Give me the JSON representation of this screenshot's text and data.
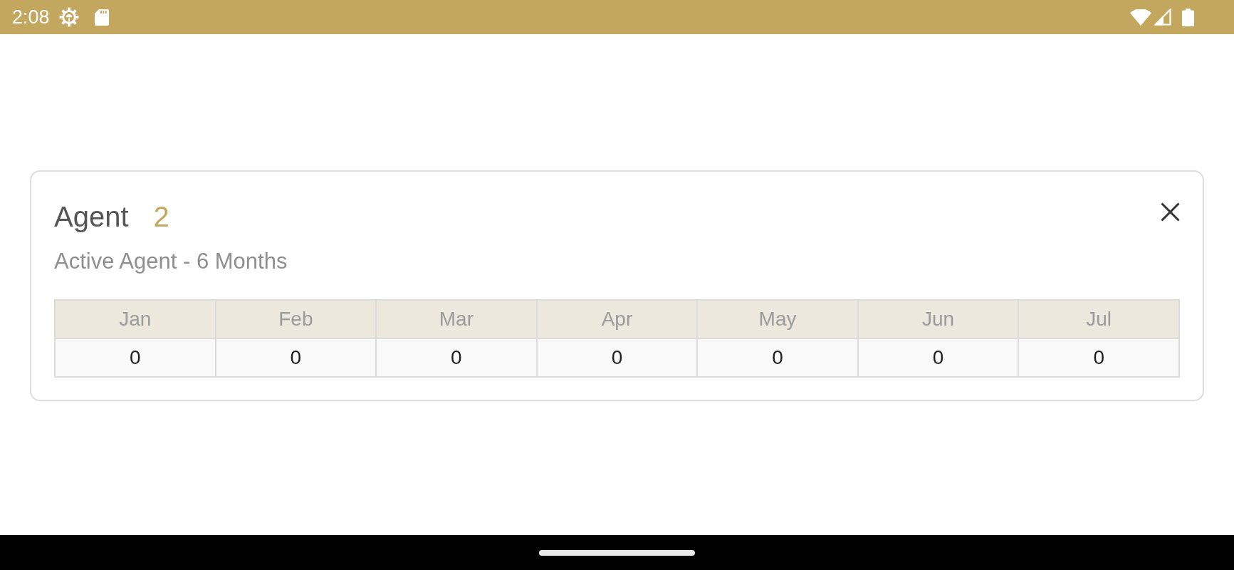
{
  "status_bar": {
    "time": "2:08"
  },
  "card": {
    "title": "Agent",
    "count": "2",
    "subtitle": "Active Agent - 6 Months"
  },
  "table": {
    "columns": [
      "Jan",
      "Feb",
      "Mar",
      "Apr",
      "May",
      "Jun",
      "Jul"
    ],
    "rows": [
      [
        "0",
        "0",
        "0",
        "0",
        "0",
        "0",
        "0"
      ]
    ]
  }
}
